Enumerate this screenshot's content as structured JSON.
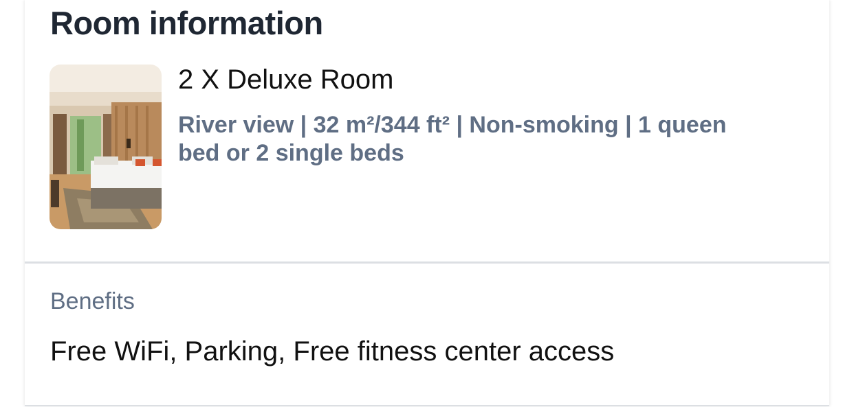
{
  "room_info": {
    "title": "Room information",
    "room": {
      "name": "2 X Deluxe Room",
      "details": "River view | 32 m²/344 ft² | Non-smoking | 1 queen bed or 2 single beds",
      "image": "hotel-room-photo"
    }
  },
  "benefits": {
    "label": "Benefits",
    "value": "Free WiFi, Parking, Free fitness center access"
  },
  "colors": {
    "heading": "#1f2733",
    "muted": "#5f6e84",
    "text": "#111111",
    "divider": "#dcdfe3"
  }
}
